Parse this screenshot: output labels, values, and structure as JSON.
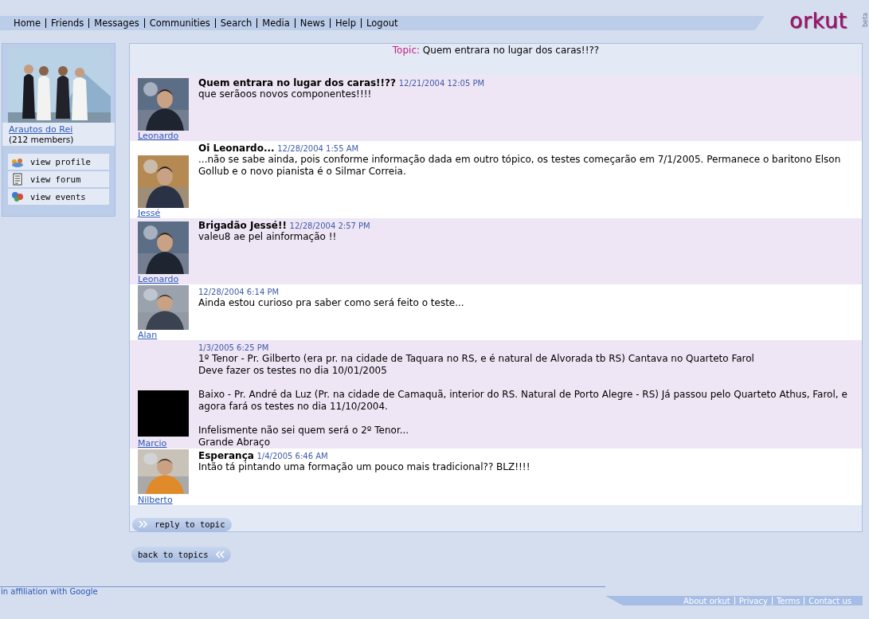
{
  "nav": {
    "links": [
      "Home",
      "Friends",
      "Messages",
      "Communities",
      "Search",
      "Media",
      "News",
      "Help",
      "Logout"
    ]
  },
  "logo": {
    "text": "orkut",
    "badge": "beta"
  },
  "community": {
    "name": "Arautos do Rei",
    "members": "(212 members)",
    "actions": [
      {
        "kind": "profile",
        "label": "view profile"
      },
      {
        "kind": "forum",
        "label": "view forum"
      },
      {
        "kind": "events",
        "label": "view events"
      }
    ]
  },
  "topic": {
    "label": "Topic:",
    "title": "Quem entrara no lugar dos caras!!??"
  },
  "posts": [
    {
      "author": "Leonardo",
      "title": "Quem entrara no lugar dos caras!!??",
      "date": "12/21/2004 12:05 PM",
      "paragraphs": [
        "que serãoos novos componentes!!!!"
      ]
    },
    {
      "author": "Jessé",
      "title": "Oi Leonardo...",
      "date": "12/28/2004 1:55 AM",
      "paragraphs": [
        "...não se sabe ainda, pois conforme informação dada em outro tópico, os testes começarão em 7/1/2005. Permanece o baritono Elson Gollub e o novo pianista é o Silmar Correia."
      ]
    },
    {
      "author": "Leonardo",
      "title": "Brigadão Jessé!!",
      "date": "12/28/2004 2:57 PM",
      "paragraphs": [
        "valeu8 ae pel ainformação !!"
      ]
    },
    {
      "author": "Alan",
      "date": "12/28/2004 6:14 PM",
      "paragraphs": [
        "Ainda estou curioso pra saber como será feito o teste..."
      ]
    },
    {
      "author": "Marcio",
      "avatar": {
        "kind": "blank"
      },
      "date": "1/3/2005 6:25 PM",
      "paragraphs": [
        "1º Tenor - Pr. Gilberto (era pr. na cidade de Taquara no RS, e é natural de Alvorada tb RS) Cantava no Quarteto Farol\nDeve fazer os testes no dia 10/01/2005",
        "Baixo - Pr. André da Luz (Pr. na cidade de Camaquã, interior do RS. Natural de Porto Alegre - RS) Já passou pelo Quarteto Athus, Farol, e agora fará os testes no dia 11/10/2004.",
        "Infelismente não sei quem será o 2º Tenor...\nGrande Abraço"
      ]
    },
    {
      "author": "Nilberto",
      "title": "Esperança",
      "date": "1/4/2005 6:46 AM",
      "paragraphs": [
        "Intão tá pintando uma formação um pouco mais tradicional?? BLZ!!!!"
      ]
    }
  ],
  "reply_button": "reply to topic",
  "back_button": "back to topics",
  "footer": {
    "affiliation": "in affiliation with Google",
    "links": [
      "About orkut",
      "Privacy",
      "Terms",
      "Contact us"
    ]
  }
}
